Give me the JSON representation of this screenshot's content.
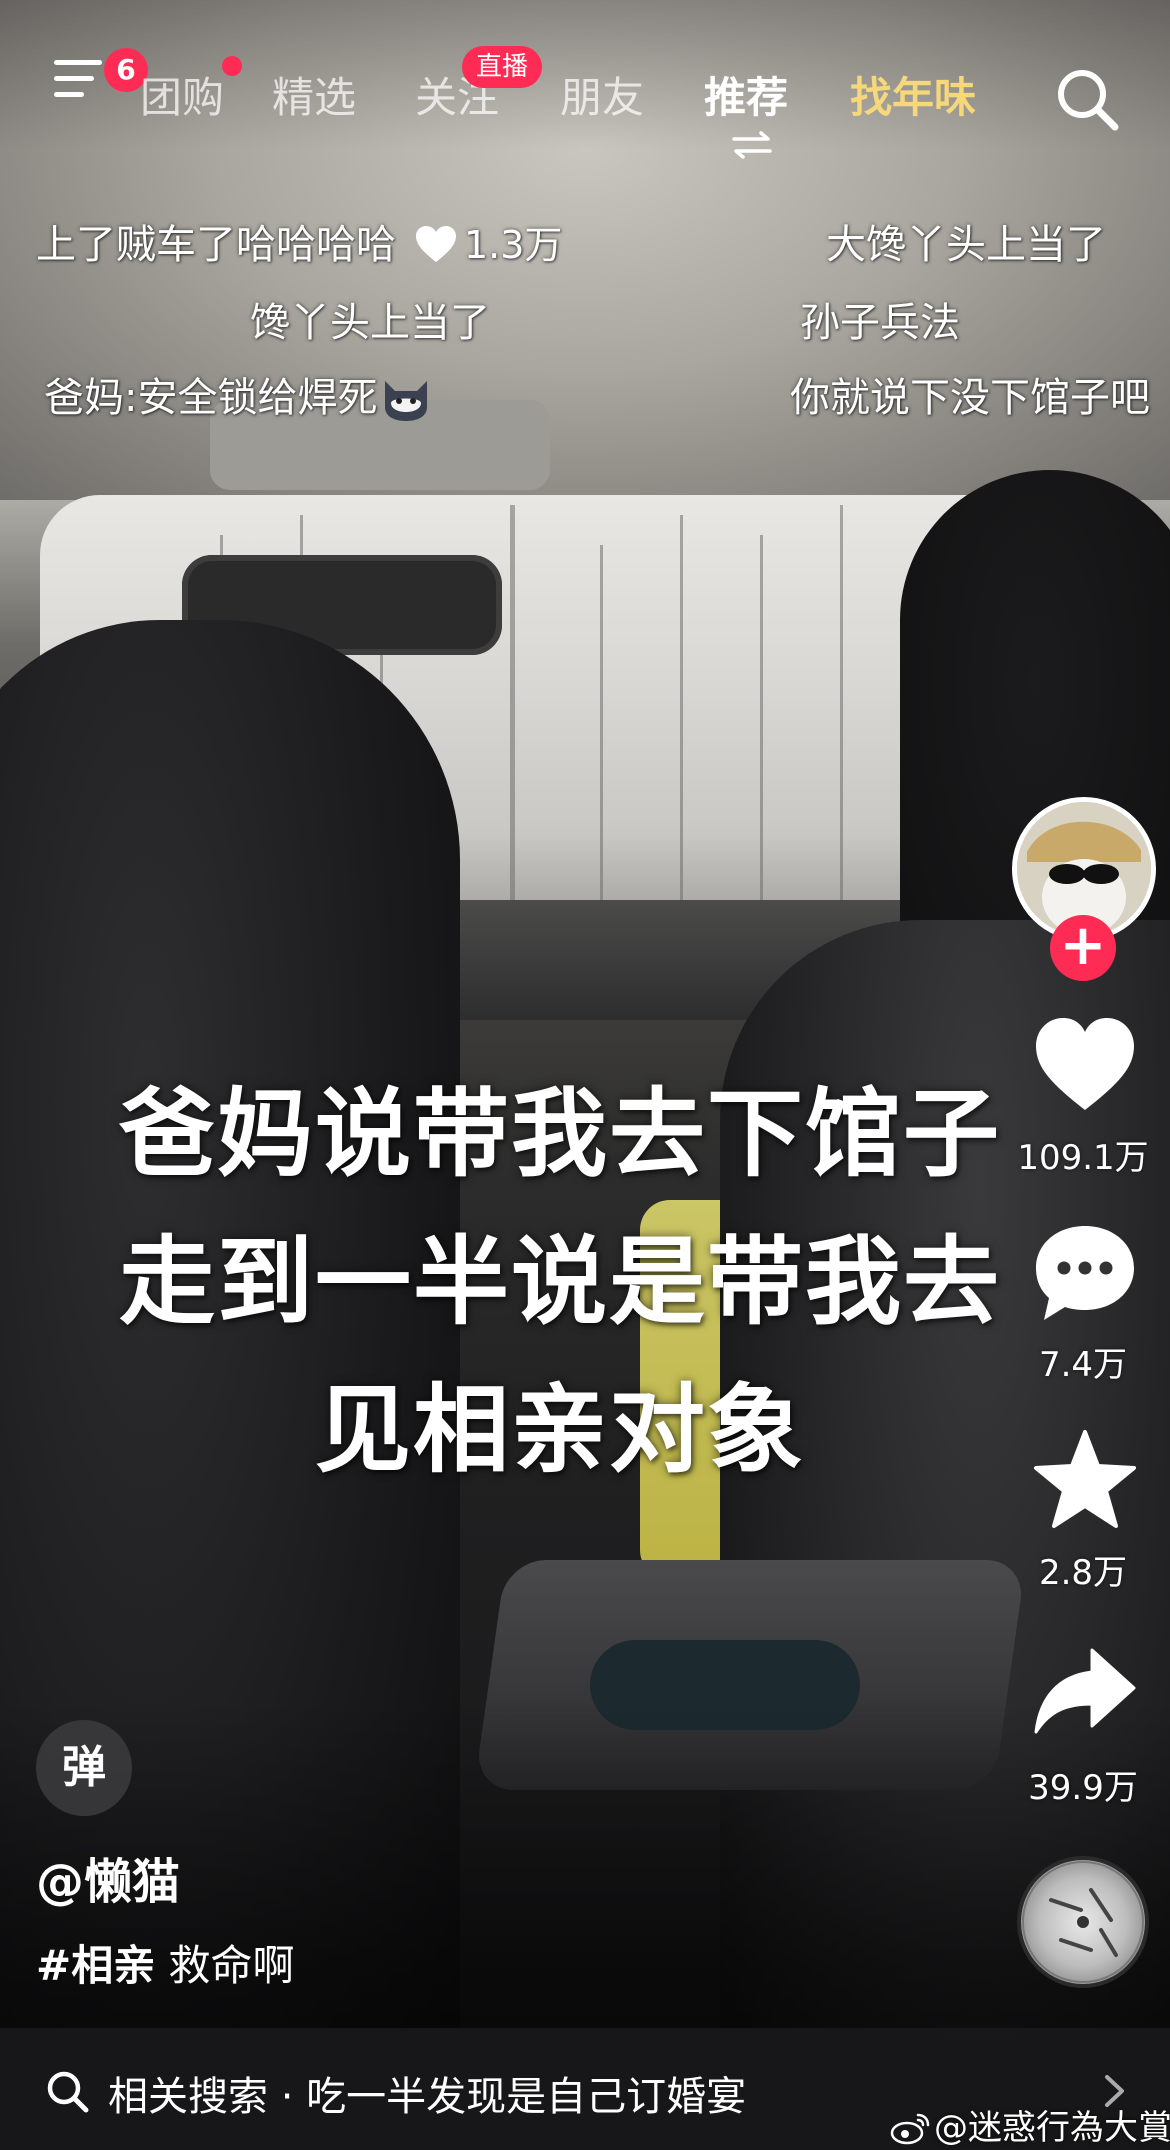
{
  "topnav": {
    "menu_badge": "6",
    "tabs": [
      "团购",
      "精选",
      "关注",
      "朋友",
      "推荐",
      "找年味"
    ],
    "live_badge": "直播",
    "active_tab": "推荐"
  },
  "danmaku": [
    {
      "text": "上了贼车了哈哈哈哈",
      "likes": "1.3万"
    },
    {
      "text": "大馋丫头上当了"
    },
    {
      "text": "馋丫头上当了"
    },
    {
      "text": "孙子兵法"
    },
    {
      "text": "爸妈:安全锁给焊死"
    },
    {
      "text": "你就说下没下馆子吧"
    }
  ],
  "caption": {
    "line1": "爸妈说带我去下馆子",
    "line2": "走到一半说是带我去",
    "line3": "见相亲对象"
  },
  "rail": {
    "likes": "109.1万",
    "comments": "7.4万",
    "favorites": "2.8万",
    "shares": "39.9万"
  },
  "bottom": {
    "danmu_toggle": "弹",
    "author": "@懒猫",
    "hashtag": "#相亲",
    "desc_text": " 救命啊",
    "related_label": "相关搜索 · 吃一半发现是自己订婚宴",
    "watermark": "@迷惑行為大賞"
  },
  "colors": {
    "accent_red": "#fe2c55",
    "special_tab": "#f6d77a"
  }
}
